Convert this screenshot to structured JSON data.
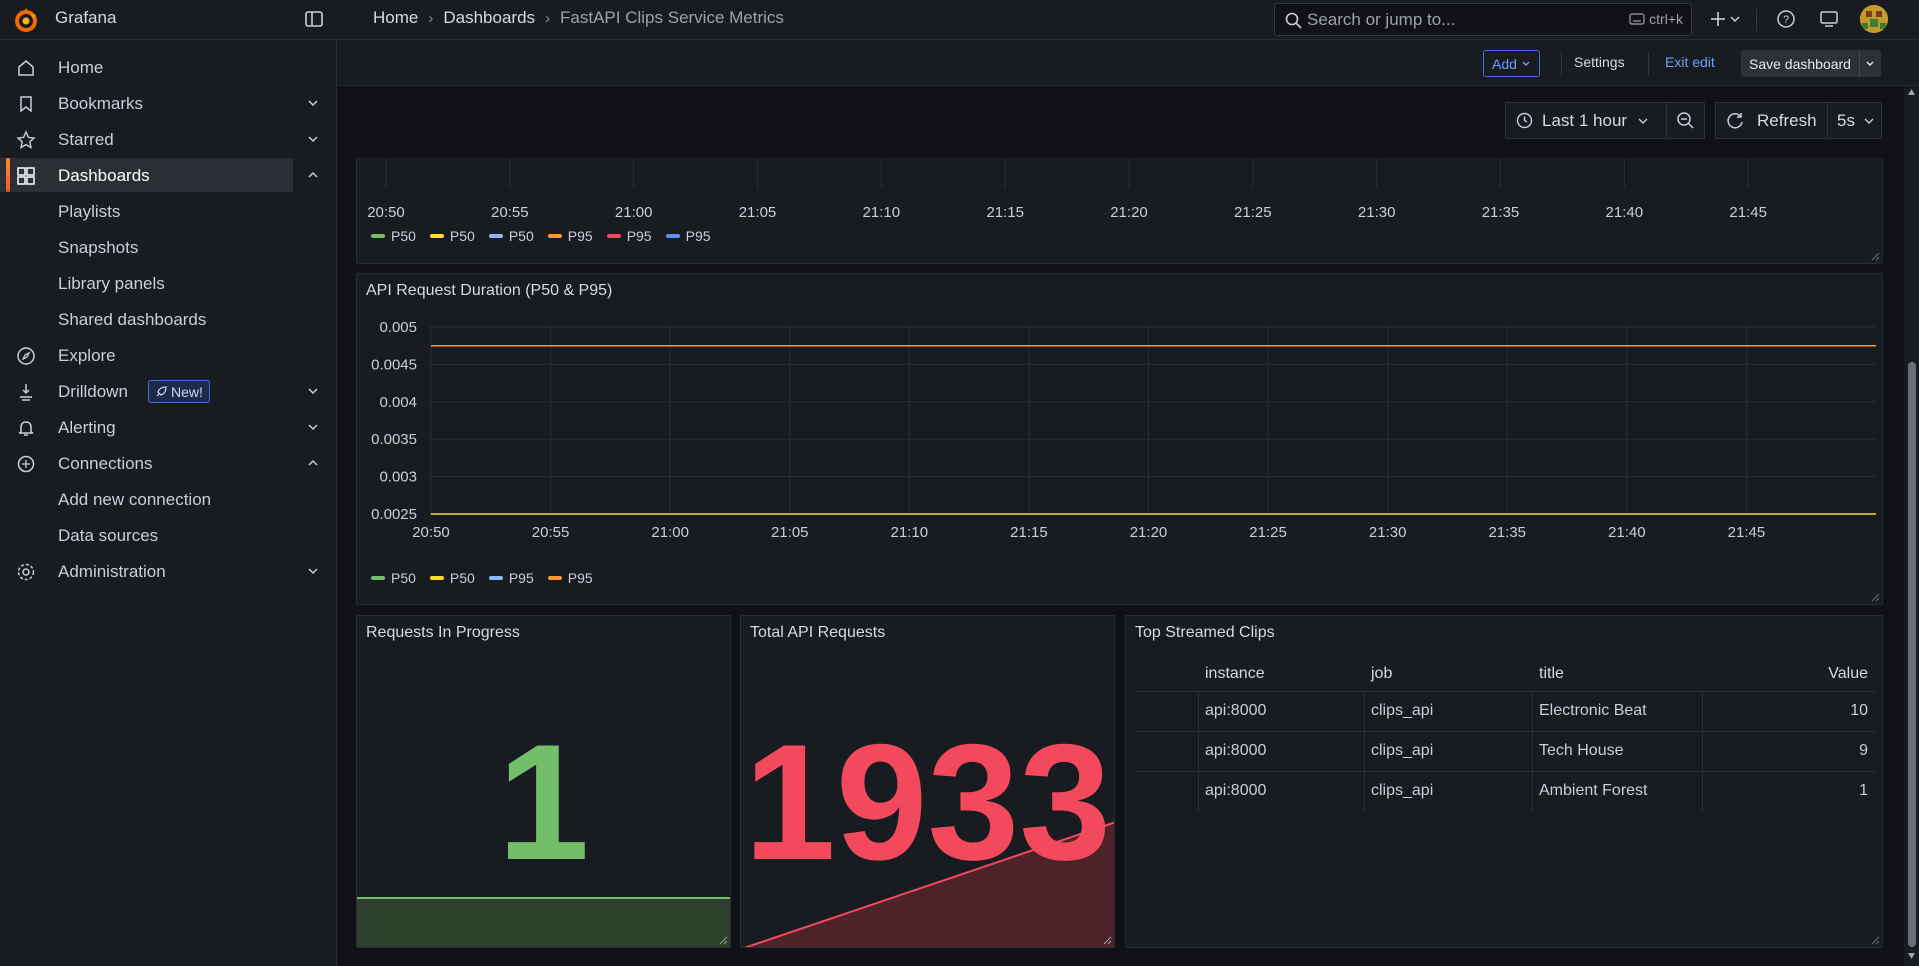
{
  "app": {
    "brand": "Grafana"
  },
  "breadcrumb": [
    "Home",
    "Dashboards",
    "FastAPI Clips Service Metrics"
  ],
  "search": {
    "placeholder": "Search or jump to...",
    "shortcut": "ctrl+k"
  },
  "sidebar": {
    "items": [
      {
        "label": "Home"
      },
      {
        "label": "Bookmarks"
      },
      {
        "label": "Starred"
      },
      {
        "label": "Dashboards"
      },
      {
        "label": "Playlists"
      },
      {
        "label": "Snapshots"
      },
      {
        "label": "Library panels"
      },
      {
        "label": "Shared dashboards"
      },
      {
        "label": "Explore"
      },
      {
        "label": "Drilldown",
        "badge": "New!"
      },
      {
        "label": "Alerting"
      },
      {
        "label": "Connections"
      },
      {
        "label": "Add new connection"
      },
      {
        "label": "Data sources"
      },
      {
        "label": "Administration"
      }
    ]
  },
  "editbar": {
    "add": "Add",
    "settings": "Settings",
    "exit": "Exit edit",
    "save": "Save dashboard"
  },
  "timebar": {
    "range": "Last 1 hour",
    "refresh": "Refresh",
    "interval": "5s"
  },
  "colors": {
    "green": "#73bf69",
    "yellow": "#fade2a",
    "blue": "#5794f2",
    "orange": "#ff9830",
    "red": "#f2495c"
  },
  "top_panel": {
    "x_ticks": [
      "20:50",
      "20:55",
      "21:00",
      "21:05",
      "21:10",
      "21:15",
      "21:20",
      "21:25",
      "21:30",
      "21:35",
      "21:40",
      "21:45"
    ],
    "legend": [
      {
        "label": "P50",
        "color": "#73bf69"
      },
      {
        "label": "P50",
        "color": "#fade2a"
      },
      {
        "label": "P50",
        "color": "#8ab8ff"
      },
      {
        "label": "P95",
        "color": "#ff9830"
      },
      {
        "label": "P95",
        "color": "#f2495c"
      },
      {
        "label": "P95",
        "color": "#5794f2"
      }
    ]
  },
  "chart_data": [
    {
      "type": "line",
      "title": "API Request Duration (P50 & P95)",
      "x": [
        "20:50",
        "20:55",
        "21:00",
        "21:05",
        "21:10",
        "21:15",
        "21:20",
        "21:25",
        "21:30",
        "21:35",
        "21:40",
        "21:45"
      ],
      "y_ticks": [
        "0.005",
        "0.0045",
        "0.004",
        "0.0035",
        "0.003",
        "0.0025"
      ],
      "ylim": [
        0.0025,
        0.005
      ],
      "grid": true,
      "series": [
        {
          "name": "P50",
          "color": "#73bf69",
          "values": []
        },
        {
          "name": "P50",
          "color": "#fade2a",
          "values": [
            0.0025,
            0.0025,
            0.0025,
            0.0025,
            0.0025,
            0.0025,
            0.0025,
            0.0025,
            0.0025,
            0.0025,
            0.0025,
            0.0025
          ]
        },
        {
          "name": "P95",
          "color": "#8ab8ff",
          "values": []
        },
        {
          "name": "P95",
          "color": "#ff9830",
          "values": [
            0.00475,
            0.00475,
            0.00475,
            0.00475,
            0.00475,
            0.00475,
            0.00475,
            0.00475,
            0.00475,
            0.00475,
            0.00475,
            0.00475
          ]
        }
      ],
      "legend_position": "bottom-left"
    }
  ],
  "stats": {
    "in_progress": {
      "title": "Requests In Progress",
      "value": "1",
      "color": "#73bf69"
    },
    "total": {
      "title": "Total API Requests",
      "value": "1933",
      "color": "#f2495c"
    }
  },
  "table": {
    "title": "Top Streamed Clips",
    "columns": [
      "instance",
      "job",
      "title",
      "Value"
    ],
    "rows": [
      [
        "api:8000",
        "clips_api",
        "Electronic Beat",
        "10"
      ],
      [
        "api:8000",
        "clips_api",
        "Tech House",
        "9"
      ],
      [
        "api:8000",
        "clips_api",
        "Ambient Forest",
        "1"
      ]
    ]
  }
}
